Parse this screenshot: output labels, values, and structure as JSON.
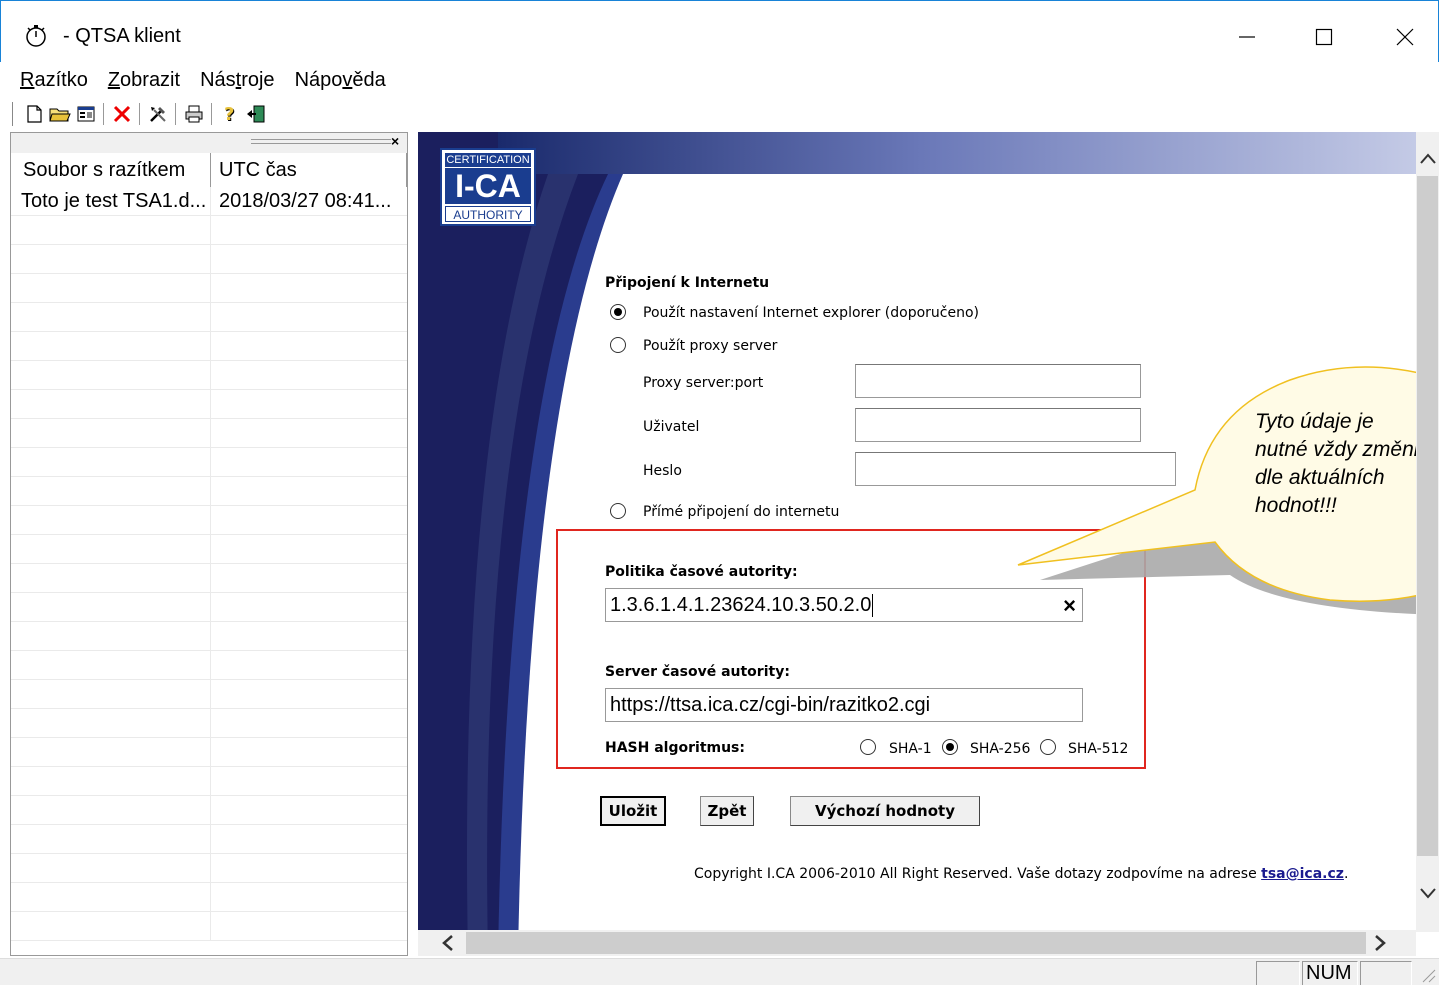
{
  "window": {
    "title": " - QTSA klient",
    "app_icon": "stopwatch-icon",
    "controls": {
      "minimize": "minimize-icon",
      "maximize": "maximize-icon",
      "close": "close-icon"
    }
  },
  "menu": {
    "items": [
      {
        "label": "Razítko",
        "accel": "R"
      },
      {
        "label": "Zobrazit",
        "accel": "Z"
      },
      {
        "label": "Nástroje",
        "accel": "t"
      },
      {
        "label": "Nápověda",
        "accel": "v"
      }
    ]
  },
  "toolbar": {
    "buttons": [
      "new-document-icon",
      "open-folder-icon",
      "properties-icon",
      "delete-icon",
      "tools-icon",
      "print-icon",
      "help-icon",
      "exit-icon"
    ]
  },
  "list": {
    "columns": [
      "Soubor s razítkem",
      "UTC čas"
    ],
    "rows": [
      {
        "file": "Toto je test TSA1.d...",
        "time": "2018/03/27  08:41..."
      }
    ],
    "pane_close": "×"
  },
  "web": {
    "logo": {
      "top": "CERTIFICATION",
      "mid": "I-CA",
      "bottom": "AUTHORITY"
    },
    "internet": {
      "title": "Připojení k Internetu",
      "opt_ie": "Použít nastavení Internet explorer (doporučeno)",
      "opt_proxy": "Použít proxy server",
      "proxy_label": "Proxy server:port",
      "user_label": "Uživatel",
      "pass_label": "Heslo",
      "opt_direct": "Přímé připojení do internetu",
      "selected": "ie"
    },
    "policy": {
      "title": "Politika časové autority:",
      "value": "1.3.6.1.4.1.23624.10.3.50.2.0",
      "clear": "×"
    },
    "server": {
      "title": "Server časové autority:",
      "value": "https://ttsa.ica.cz/cgi-bin/razitko2.cgi"
    },
    "hash": {
      "title": "HASH algoritmus:",
      "options": [
        "SHA-1",
        "SHA-256",
        "SHA-512"
      ],
      "selected": "SHA-256"
    },
    "buttons": {
      "save": "Uložit",
      "back": "Zpět",
      "defaults": "Výchozí hodnoty"
    },
    "copyright": {
      "text": "Copyright I.CA 2006-2010 All Right Reserved. Vaše dotazy zodpovíme na adrese ",
      "email": "tsa@ica.cz",
      "end": "."
    }
  },
  "callout": {
    "lines": [
      "Tyto údaje je",
      "nutné vždy změnit",
      "dle aktuálních",
      "hodnot!!!"
    ]
  },
  "status": {
    "num": "NUM"
  },
  "colors": {
    "accent": "#1a3d8f",
    "highlight_box": "#e0261f",
    "callout_fill": "#fff5c2",
    "callout_border": "#f0c020"
  }
}
